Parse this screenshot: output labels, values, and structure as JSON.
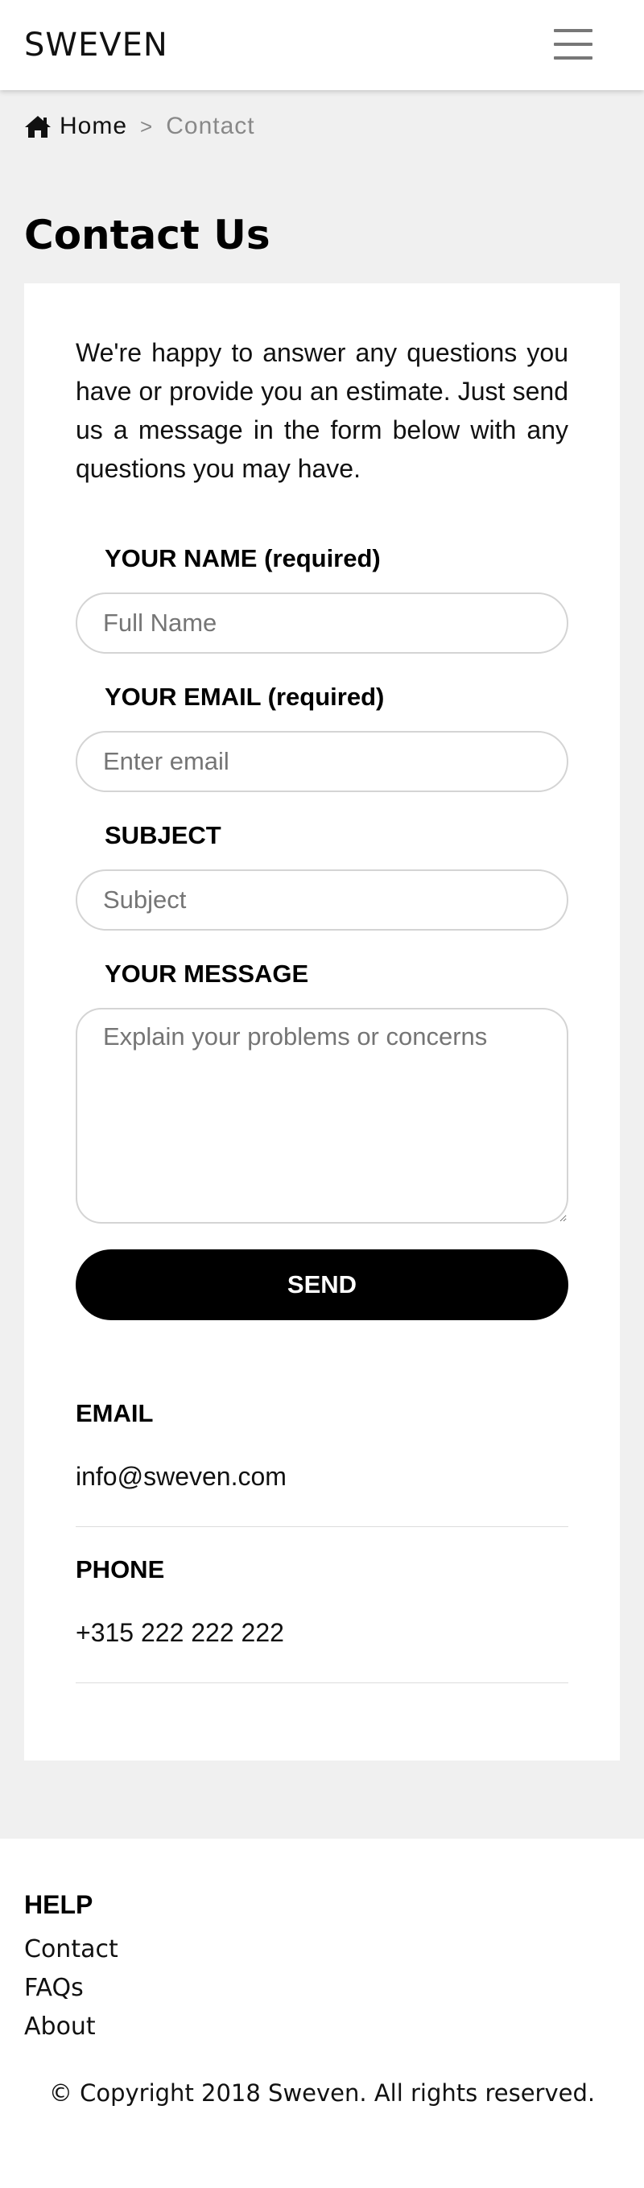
{
  "header": {
    "brand": "SWEVEN",
    "menu_icon": "hamburger-menu-icon"
  },
  "breadcrumb": {
    "home_icon": "home-icon",
    "home": "Home",
    "separator": ">",
    "current": "Contact"
  },
  "page": {
    "title": "Contact Us",
    "intro": "We're happy to answer any questions you have or provide you an estimate. Just send us a message in the form below with any questions you may have."
  },
  "form": {
    "name_label": "YOUR NAME (required)",
    "name_placeholder": "Full Name",
    "name_value": "",
    "email_label": "YOUR EMAIL (required)",
    "email_placeholder": "Enter email",
    "email_value": "",
    "subject_label": "SUBJECT",
    "subject_placeholder": "Subject",
    "subject_value": "",
    "message_label": "YOUR MESSAGE",
    "message_placeholder": "Explain your problems or concerns",
    "message_value": "",
    "send_label": "SEND"
  },
  "contact_info": {
    "email_heading": "EMAIL",
    "email_value": "info@sweven.com",
    "phone_heading": "PHONE",
    "phone_value": "+315 222 222 222"
  },
  "footer": {
    "help_heading": "HELP",
    "links": [
      "Contact",
      "FAQs",
      "About"
    ],
    "copyright": "© Copyright 2018 Sweven. All rights reserved."
  },
  "colors": {
    "page_background": "#f0f0f0",
    "card_background": "#ffffff",
    "button_background": "#000000",
    "button_text": "#ffffff",
    "muted_text": "#888888"
  }
}
